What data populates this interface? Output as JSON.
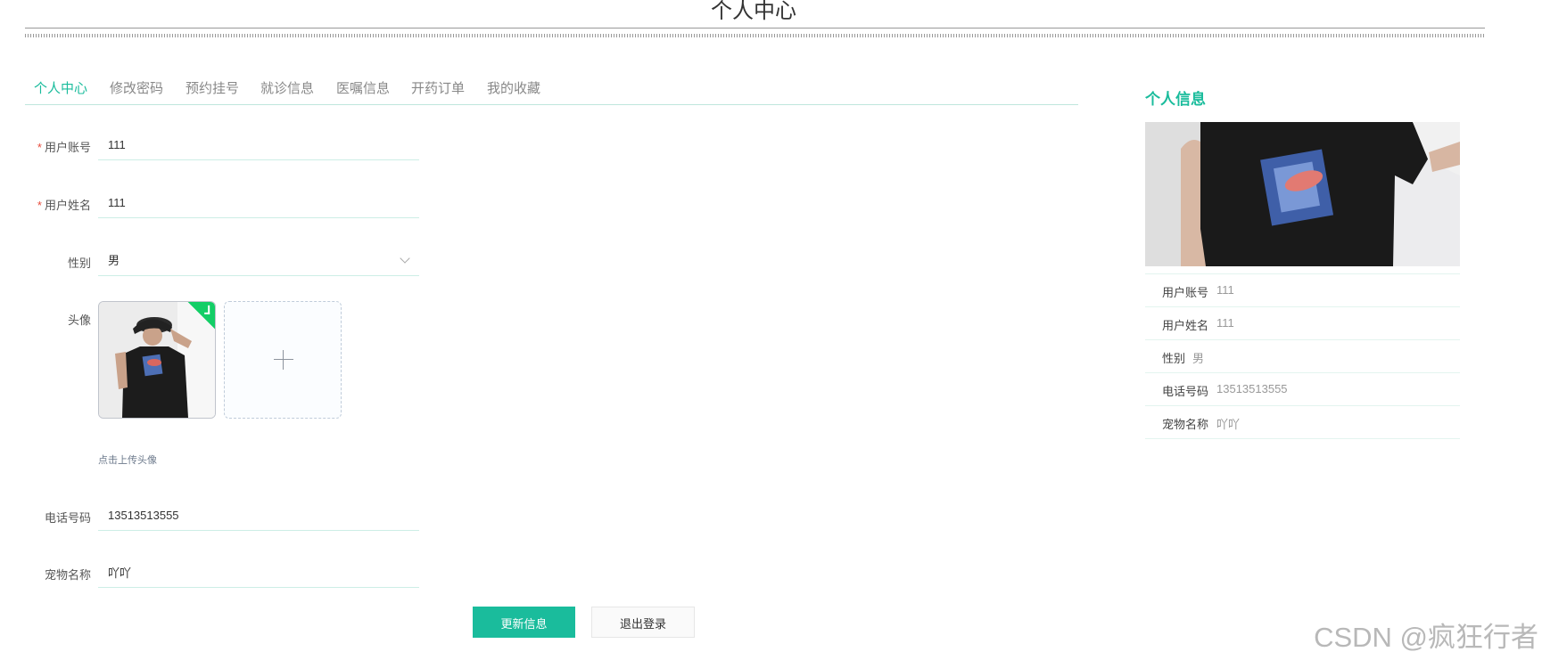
{
  "page": {
    "title": "个人中心"
  },
  "tabs": [
    {
      "label": "个人中心",
      "active": true
    },
    {
      "label": "修改密码",
      "active": false
    },
    {
      "label": "预约挂号",
      "active": false
    },
    {
      "label": "就诊信息",
      "active": false
    },
    {
      "label": "医嘱信息",
      "active": false
    },
    {
      "label": "开药订单",
      "active": false
    },
    {
      "label": "我的收藏",
      "active": false
    }
  ],
  "form": {
    "required_mark": "*",
    "account": {
      "label": "用户账号",
      "value": "111"
    },
    "name": {
      "label": "用户姓名",
      "value": "111"
    },
    "gender": {
      "label": "性别",
      "value": "男"
    },
    "avatar": {
      "label": "头像",
      "tip": "点击上传头像"
    },
    "phone": {
      "label": "电话号码",
      "value": "13513513555"
    },
    "pet": {
      "label": "宠物名称",
      "value": "吖吖"
    }
  },
  "buttons": {
    "update": "更新信息",
    "logout": "退出登录"
  },
  "info": {
    "title": "个人信息",
    "rows": [
      {
        "label": "用户账号",
        "value": "111"
      },
      {
        "label": "用户姓名",
        "value": "111"
      },
      {
        "label": "性别",
        "value": "男"
      },
      {
        "label": "电话号码",
        "value": "13513513555"
      },
      {
        "label": "宠物名称",
        "value": "吖吖"
      }
    ]
  },
  "watermark": "CSDN @疯狂行者",
  "colors": {
    "accent": "#1abc9c",
    "required": "#e74c3c",
    "success": "#13ce66"
  }
}
